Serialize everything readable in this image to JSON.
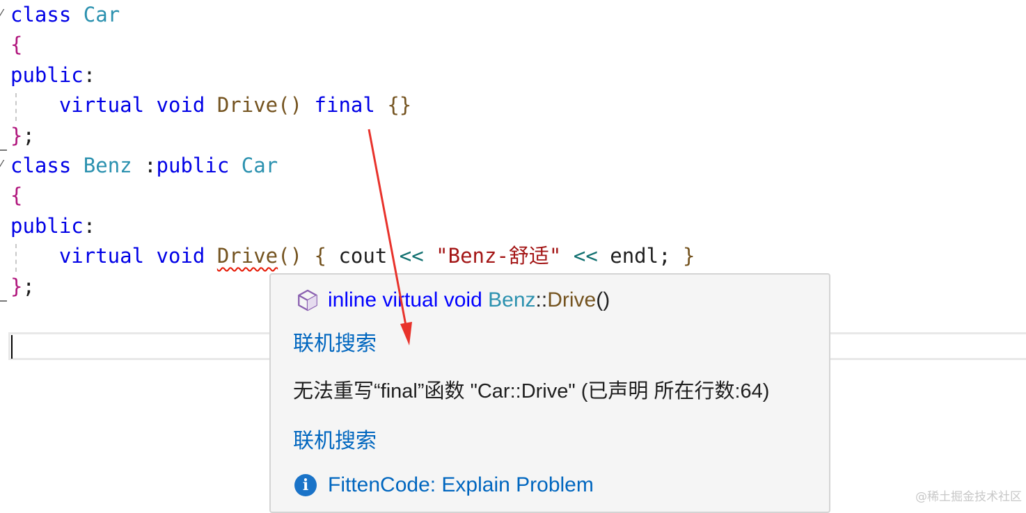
{
  "code": {
    "lines": [
      [
        {
          "c": "kw",
          "t": "class"
        },
        {
          "c": "plain",
          "t": " "
        },
        {
          "c": "type",
          "t": "Car"
        }
      ],
      [
        {
          "c": "brace-m",
          "t": "{"
        }
      ],
      [
        {
          "c": "kw",
          "t": "public"
        },
        {
          "c": "plain",
          "t": ":"
        }
      ],
      [
        {
          "c": "plain",
          "t": "    "
        },
        {
          "c": "kw",
          "t": "virtual"
        },
        {
          "c": "plain",
          "t": " "
        },
        {
          "c": "kw",
          "t": "void"
        },
        {
          "c": "plain",
          "t": " "
        },
        {
          "c": "fn",
          "t": "Drive"
        },
        {
          "c": "fn",
          "t": "()"
        },
        {
          "c": "plain",
          "t": " "
        },
        {
          "c": "kw",
          "t": "final"
        },
        {
          "c": "plain",
          "t": " "
        },
        {
          "c": "fn",
          "t": "{}"
        }
      ],
      [
        {
          "c": "brace-m",
          "t": "}"
        },
        {
          "c": "plain",
          "t": ";"
        }
      ],
      [
        {
          "c": "kw",
          "t": "class"
        },
        {
          "c": "plain",
          "t": " "
        },
        {
          "c": "type",
          "t": "Benz"
        },
        {
          "c": "plain",
          "t": " :"
        },
        {
          "c": "kw",
          "t": "public"
        },
        {
          "c": "plain",
          "t": " "
        },
        {
          "c": "type",
          "t": "Car"
        }
      ],
      [
        {
          "c": "brace-m",
          "t": "{"
        }
      ],
      [
        {
          "c": "kw",
          "t": "public"
        },
        {
          "c": "plain",
          "t": ":"
        }
      ],
      [
        {
          "c": "plain",
          "t": "    "
        },
        {
          "c": "kw",
          "t": "virtual"
        },
        {
          "c": "plain",
          "t": " "
        },
        {
          "c": "kw",
          "t": "void"
        },
        {
          "c": "plain",
          "t": " "
        },
        {
          "c": "fn squiggle",
          "t": "Drive"
        },
        {
          "c": "fn",
          "t": "()"
        },
        {
          "c": "plain",
          "t": " "
        },
        {
          "c": "fn",
          "t": "{"
        },
        {
          "c": "plain",
          "t": " cout "
        },
        {
          "c": "op",
          "t": "<<"
        },
        {
          "c": "plain",
          "t": " "
        },
        {
          "c": "str",
          "t": "\"Benz-舒适\""
        },
        {
          "c": "plain",
          "t": " "
        },
        {
          "c": "op",
          "t": "<<"
        },
        {
          "c": "plain",
          "t": " endl; "
        },
        {
          "c": "fn",
          "t": "}"
        }
      ],
      [
        {
          "c": "brace-m",
          "t": "}"
        },
        {
          "c": "plain",
          "t": ";"
        }
      ]
    ]
  },
  "tooltip": {
    "signature": {
      "prefix": "inline virtual void ",
      "class_name": "Benz",
      "sep": "::",
      "method": "Drive",
      "parens": "()"
    },
    "online_search_1": "联机搜索",
    "error_message": "无法重写“final”函数 \"Car::Drive\" (已声明 所在行数:64)",
    "online_search_2": "联机搜索",
    "fitten_action": "FittenCode: Explain Problem"
  },
  "watermark": "@稀土掘金技术社区",
  "icons": {
    "symbol": "cube-icon",
    "info": "info-icon",
    "fold": "collapse-icon"
  }
}
